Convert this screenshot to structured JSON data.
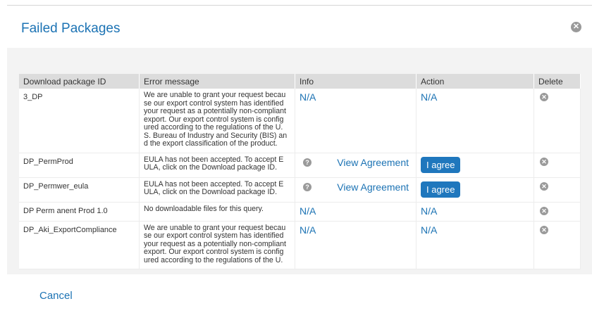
{
  "dialog": {
    "title": "Failed Packages",
    "close_icon": "close-icon",
    "cancel_label": "Cancel"
  },
  "table": {
    "headers": [
      "Download package ID",
      "Error message",
      "Info",
      "Action",
      "Delete"
    ],
    "rows": [
      {
        "id": "3_DP",
        "message": "We are unable to grant your request becau se our export control system has identified your request as a potentially non-compliant export. Our export control system is config ured according to the regulations of the U. S. Bureau of Industry and Security (BIS) an d the export classification of the product.",
        "info": "N/A",
        "action": "N/A"
      },
      {
        "id": "DP_PermProd",
        "message": "EULA has not been accepted. To accept E ULA, click on the Download package ID.",
        "info": "View Agreement",
        "action": "I agree"
      },
      {
        "id": "DP_Permwer_eula",
        "message": "EULA has not been accepted. To accept E ULA, click on the Download package ID.",
        "info": "View Agreement",
        "action": "I agree"
      },
      {
        "id": "DP Perm anent Prod 1.0",
        "message": "No downloadable files for this query.",
        "info": "N/A",
        "action": "N/A"
      },
      {
        "id": "DP_Aki_ExportCompliance",
        "message": "We are unable to grant your request becau se our export control system has identified your request as a potentially non-compliant export. Our export control system is config ured according to the regulations of the U.",
        "info": "N/A",
        "action": "N/A"
      }
    ]
  },
  "icons": {
    "info": "question-icon",
    "delete": "delete-icon"
  }
}
